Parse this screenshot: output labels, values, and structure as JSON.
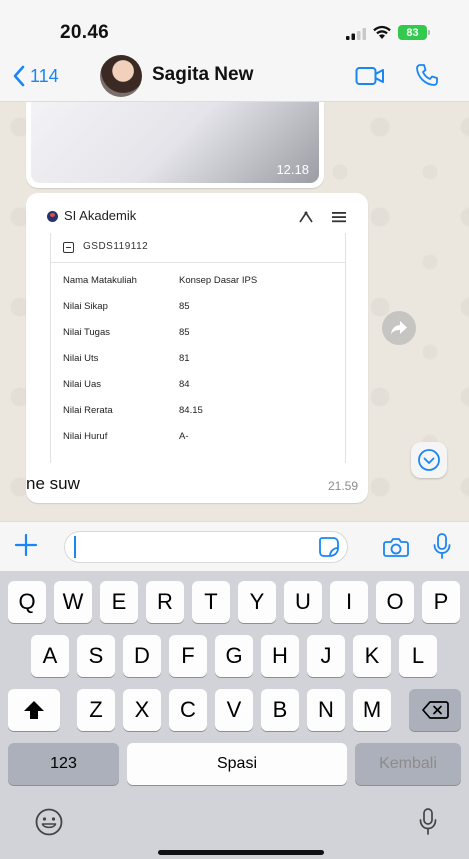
{
  "status_bar": {
    "time": "20.46",
    "battery": "83"
  },
  "header": {
    "back_count": "114",
    "contact_name": "Sagita New"
  },
  "messages": {
    "image_time": "12.18",
    "document": {
      "site_name": "SI Akademik",
      "code": "GSDS119112",
      "rows": [
        {
          "label": "Nama Matakuliah",
          "value": "Konsep Dasar IPS"
        },
        {
          "label": "Nilai Sikap",
          "value": "85"
        },
        {
          "label": "Nilai Tugas",
          "value": "85"
        },
        {
          "label": "Nilai Uts",
          "value": "81"
        },
        {
          "label": "Nilai Uas",
          "value": "84"
        },
        {
          "label": "Nilai Rerata",
          "value": "84.15"
        },
        {
          "label": "Nilai Huruf",
          "value": "A-"
        }
      ]
    },
    "caption": "ne suw",
    "caption_time": "21.59"
  },
  "keyboard": {
    "row1": [
      "Q",
      "W",
      "E",
      "R",
      "T",
      "Y",
      "U",
      "I",
      "O",
      "P"
    ],
    "row2": [
      "A",
      "S",
      "D",
      "F",
      "G",
      "H",
      "J",
      "K",
      "L"
    ],
    "row3": [
      "Z",
      "X",
      "C",
      "V",
      "B",
      "N",
      "M"
    ],
    "numbers_label": "123",
    "space_label": "Spasi",
    "return_label": "Kembali"
  },
  "colors": {
    "accent": "#1a86f5",
    "battery": "#33c94d",
    "keyboard_bg": "#d1d3d9"
  },
  "icons": [
    "back-chevron-icon",
    "video-call-icon",
    "phone-call-icon",
    "forward-icon",
    "scroll-down-icon",
    "plus-icon",
    "sticker-icon",
    "camera-icon",
    "mic-icon",
    "shift-icon",
    "backspace-icon",
    "emoji-icon",
    "dictation-icon"
  ]
}
